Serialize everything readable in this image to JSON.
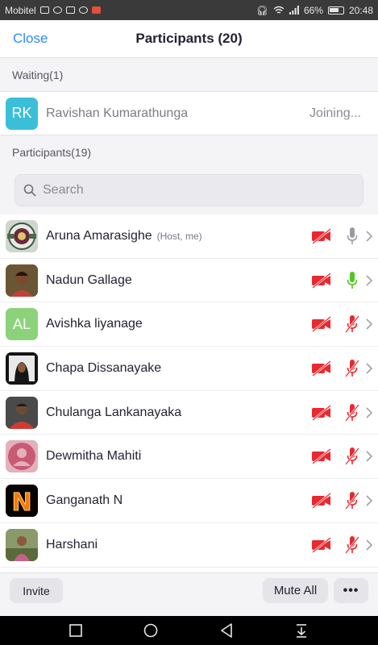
{
  "status_bar": {
    "carrier": "Mobitel",
    "battery": "66%",
    "time": "20:48"
  },
  "header": {
    "close_label": "Close",
    "title": "Participants (20)"
  },
  "waiting": {
    "header": "Waiting(1)",
    "person": {
      "initials": "RK",
      "name": "Ravishan Kumarathunga",
      "status": "Joining...",
      "color": "#3bbfd9"
    }
  },
  "participants_section": {
    "header": "Participants(19)",
    "search_placeholder": "Search"
  },
  "participants": [
    {
      "name": "Aruna Amarasighe",
      "tag": "(Host, me)",
      "avatar": "logo-seal",
      "video_off": true,
      "mic": "gray"
    },
    {
      "name": "Nadun Gallage",
      "tag": "",
      "avatar": "photo-person",
      "video_off": true,
      "mic": "green"
    },
    {
      "name": "Avishka liyanage",
      "tag": "",
      "avatar": "initials",
      "initials": "AL",
      "avatar_color": "#8cd27a",
      "video_off": true,
      "mic": "muted"
    },
    {
      "name": "Chapa Dissanayake",
      "tag": "",
      "avatar": "photo-person-dark",
      "video_off": true,
      "mic": "muted"
    },
    {
      "name": "Chulanga Lankanayaka",
      "tag": "",
      "avatar": "photo-person-red",
      "video_off": true,
      "mic": "muted"
    },
    {
      "name": "Dewmitha Mahiti",
      "tag": "",
      "avatar": "silhouette",
      "video_off": true,
      "mic": "muted"
    },
    {
      "name": "Ganganath N",
      "tag": "",
      "avatar": "fire-letter",
      "video_off": true,
      "mic": "muted"
    },
    {
      "name": "Harshani",
      "tag": "",
      "avatar": "photo-outdoor",
      "video_off": true,
      "mic": "muted"
    }
  ],
  "footer": {
    "invite_label": "Invite",
    "mute_all_label": "Mute All",
    "more_label": "•••"
  },
  "colors": {
    "accent": "#2d8cff",
    "muted_red": "#e8292f",
    "mic_green": "#4fc820",
    "mic_gray": "#9a9aa3"
  }
}
